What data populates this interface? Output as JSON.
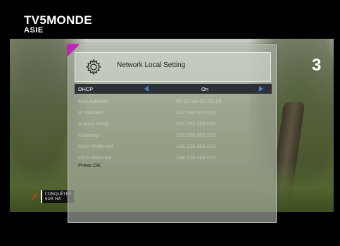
{
  "channel": {
    "name": "TV5MONDE",
    "region": "ASIE"
  },
  "corner_logo": {
    "text": "3"
  },
  "bug": {
    "line1": "CONQUÊTES",
    "line2": "SUR",
    "line3": "HA"
  },
  "dialog": {
    "title": "Network Local Setting",
    "icon": "gear-icon",
    "accent_color": "#c61ec0",
    "selection_color": "#2c3138",
    "arrow_color": "#4d86d4",
    "rows": [
      {
        "label": "DHCP",
        "value": "On"
      },
      {
        "label": "Mac Address",
        "value": "00-18-9A-0C-00-24"
      },
      {
        "label": "IP Address",
        "value": "192.168.000.005"
      },
      {
        "label": "Subnet Mask",
        "value": "255.255.255.000"
      },
      {
        "label": "Gateway",
        "value": "192.168.000.001"
      },
      {
        "label": "DNS Preferred",
        "value": "168.126.063.001"
      },
      {
        "label": "DNS Alternate",
        "value": "168.126.063.002"
      }
    ],
    "hint": "Press OK"
  }
}
